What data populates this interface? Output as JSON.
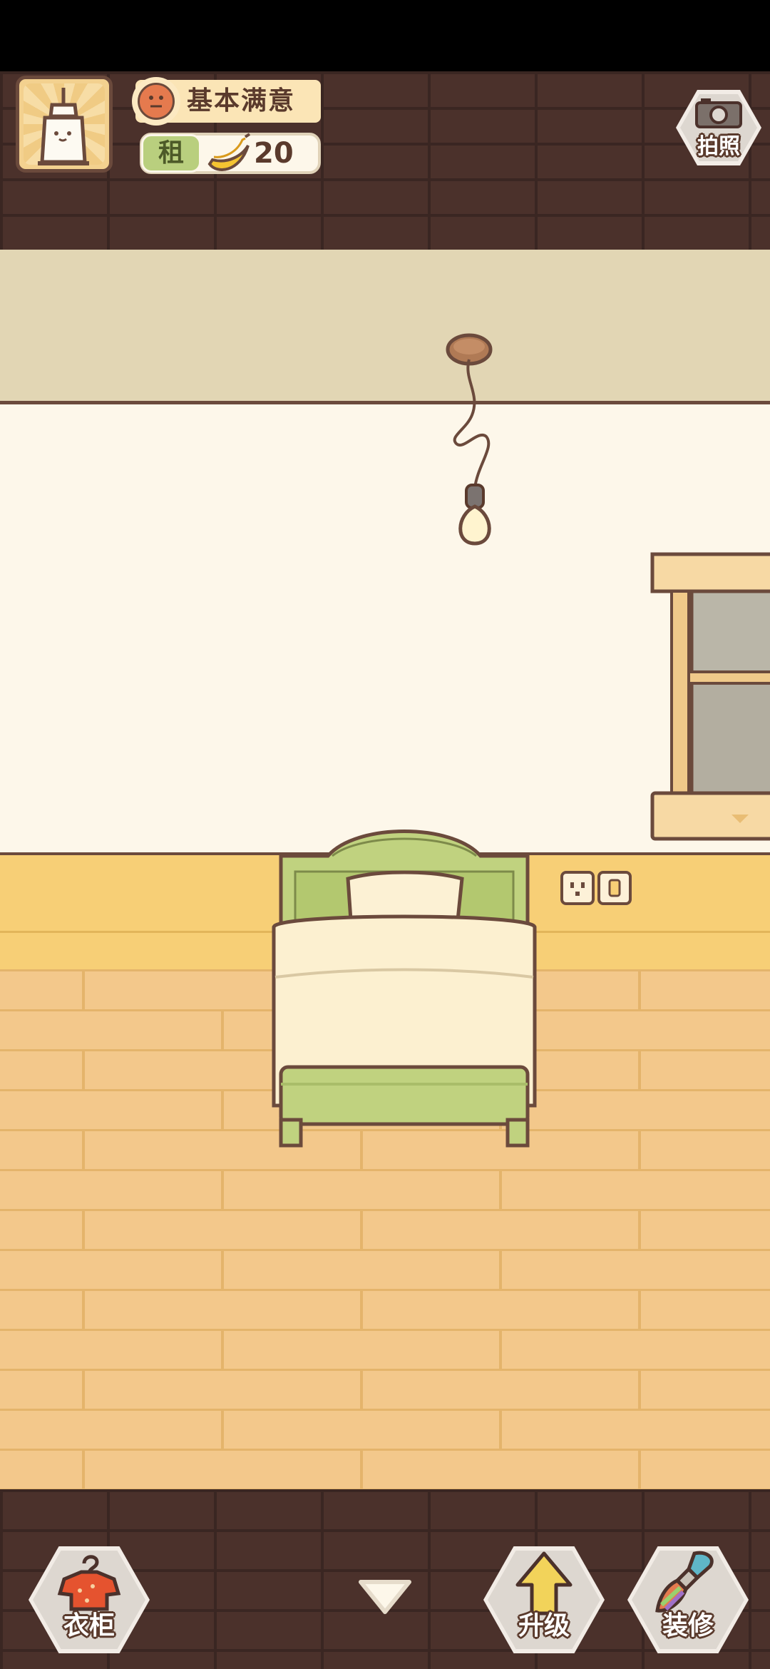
{
  "hud": {
    "satisfaction_label": "基本满意",
    "rent_badge": "租",
    "rent_value": "20",
    "photo_label": "拍照"
  },
  "bottom_bar": {
    "wardrobe_label": "衣柜",
    "upgrade_label": "升级",
    "decorate_label": "装修"
  },
  "icons": {
    "avatar": "tenant-avatar",
    "satisfaction": "neutral-face-icon",
    "rent_currency": "banana-icon",
    "photo": "camera-icon",
    "wardrobe": "hanger-shirt-icon",
    "collapse": "chevron-down-icon",
    "upgrade": "up-arrow-icon",
    "decorate": "paint-brush-icon"
  },
  "colors": {
    "brick": "#4b312b",
    "wall": "#fdf7ea",
    "ceiling": "#e2d6b4",
    "wainscot": "#f7cf76",
    "floor": "#f3c88b",
    "bed_frame": "#b9cf7e"
  }
}
